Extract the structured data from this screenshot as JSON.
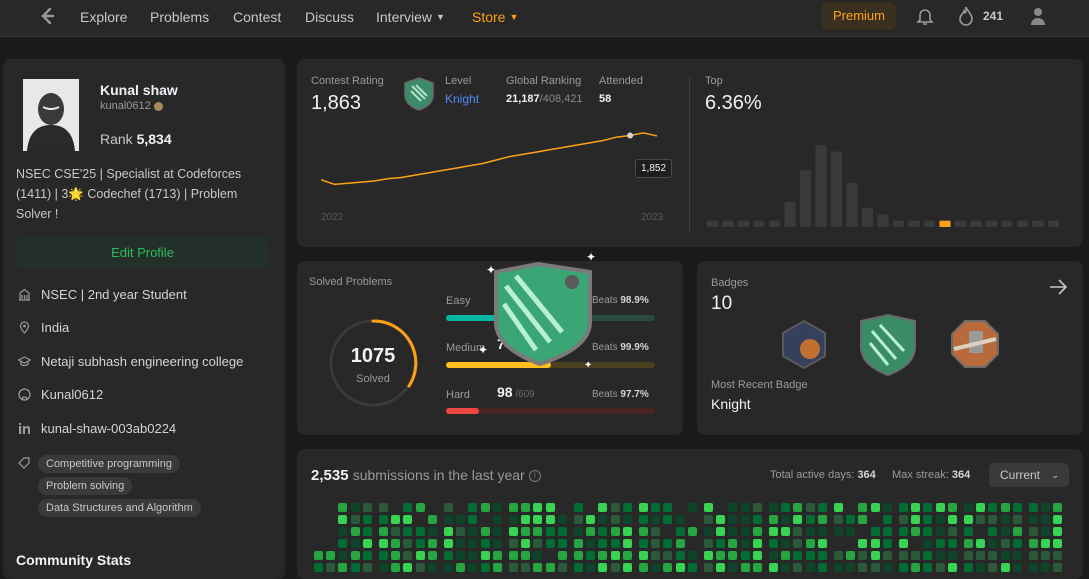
{
  "nav": {
    "items": [
      "Explore",
      "Problems",
      "Contest",
      "Discuss",
      "Interview",
      "Store"
    ],
    "premium": "Premium",
    "streak": "241"
  },
  "profile": {
    "name": "Kunal shaw",
    "username": "kunal0612",
    "rank_label": "Rank",
    "rank": "5,834",
    "bio": "NSEC CSE'25 | Specialist at Codeforces (1411) | 3🌟 Codechef (1713) | Problem Solver !",
    "edit": "Edit Profile",
    "details": [
      "NSEC | 2nd year Student",
      "India",
      "Netaji subhash engineering college",
      "Kunal0612",
      "kunal-shaw-003ab0224"
    ],
    "skills": [
      "Competitive programming",
      "Problem solving",
      "Data Structures and Algorithm"
    ],
    "community_stats": "Community Stats"
  },
  "contest": {
    "label": "Contest Rating",
    "rating": "1,863",
    "level_label": "Level",
    "level": "Knight",
    "global_label": "Global Ranking",
    "global_rank": "21,187",
    "global_total": "/408,421",
    "attended_label": "Attended",
    "attended": "58",
    "year_start": "2022",
    "year_end": "2023",
    "tooltip": "1,852",
    "top_label": "Top",
    "top": "6.36%"
  },
  "solved": {
    "label": "Solved Problems",
    "total": "1075",
    "sub": "Solved",
    "rows": [
      {
        "name": "Easy",
        "beats_label": "Beats",
        "beats": "98.9%",
        "fraction": 0.6,
        "color": "#00b8a3",
        "track": "#2a4a3e"
      },
      {
        "name": "Medium",
        "count": "74",
        "beats_label": "Beats",
        "beats": "99.9%",
        "fraction": 0.5,
        "color": "#ffc01e",
        "track": "#4a3f1f"
      },
      {
        "name": "Hard",
        "count": "98",
        "total": "/609",
        "beats_label": "Beats",
        "beats": "97.7%",
        "fraction": 0.16,
        "color": "#ef4743",
        "track": "#4a2424"
      }
    ]
  },
  "badges": {
    "label": "Badges",
    "count": "10",
    "recent_label": "Most Recent Badge",
    "recent": "Knight"
  },
  "submissions": {
    "count": "2,535",
    "text": "submissions in the last year",
    "active_label": "Total active days:",
    "active": "364",
    "streak_label": "Max streak:",
    "streak": "364",
    "select": "Current"
  },
  "chart_data": {
    "type": "line",
    "title": "Contest Rating",
    "x": [
      "2022",
      "2023"
    ],
    "series": [
      {
        "values": [
          1660,
          1640,
          1645,
          1650,
          1655,
          1665,
          1670,
          1680,
          1690,
          1700,
          1710,
          1720,
          1730,
          1745,
          1760,
          1770,
          1780,
          1790,
          1800,
          1810,
          1820,
          1830,
          1845,
          1852,
          1863,
          1850
        ]
      }
    ],
    "highlight": "1,852",
    "histogram": {
      "type": "bar",
      "values": [
        1,
        1,
        1,
        1,
        1,
        4,
        9,
        13,
        12,
        7,
        3,
        2,
        1,
        1,
        1,
        1,
        1,
        1,
        1,
        1,
        1,
        1,
        1
      ],
      "highlight_index": 15
    }
  }
}
